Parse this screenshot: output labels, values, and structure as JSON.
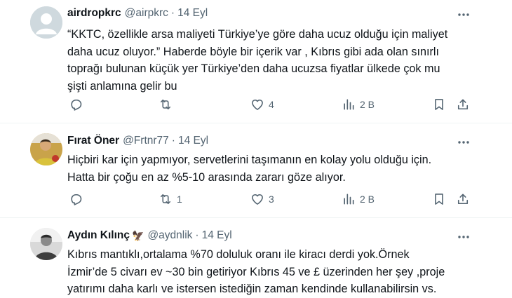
{
  "tweets": [
    {
      "name": "airdropkrc",
      "handle": "@airpkrc",
      "separator": "·",
      "date": "14 Eyl",
      "lines": [
        "“KKTC, özellikle arsa maliyeti Türkiye’ye göre daha ucuz olduğu için maliyet",
        "daha ucuz oluyor.”  Haberde böyle bir içerik var , Kıbrıs gibi ada olan sınırlı",
        "toprağı bulunan küçük yer Türkiye’den daha ucuzsa fiyatlar ülkede çok mu",
        "şişti anlamına gelir bu"
      ],
      "actions": {
        "reply": "",
        "retweet": "",
        "like": "4",
        "views": "2 B"
      }
    },
    {
      "name": "Fırat Öner",
      "handle": "@Frtnr77",
      "separator": "·",
      "date": "14 Eyl",
      "lines": [
        "Hiçbiri kar için yapmıyor,  servetlerini taşımanın en kolay yolu olduğu için.",
        "Hatta bir çoğu en az %5-10 arasında zararı göze alıyor."
      ],
      "actions": {
        "reply": "",
        "retweet": "1",
        "like": "3",
        "views": "2 B"
      }
    },
    {
      "name": "Aydın Kılınç",
      "name_emoji": "🦅",
      "handle": "@aydnlik",
      "separator": "·",
      "date": "14 Eyl",
      "lines": [
        "Kıbrıs mantıklı,ortalama %70 doluluk oranı ile kiracı derdi yok.Örnek",
        "İzmir’de 5 civarı ev ~30 bin getiriyor Kıbrıs 45 ve £ üzerinden her şey ,proje",
        "yatırımı daha karlı ve istersen istediğin zaman kendinde kullanabilirsin vs."
      ]
    }
  ],
  "icons": {
    "reply": "reply-icon",
    "retweet": "retweet-icon",
    "like": "heart-icon",
    "views": "views-chart-icon",
    "bookmark": "bookmark-icon",
    "share": "share-icon",
    "more": "more-dots-icon"
  },
  "colors": {
    "text": "#0f1419",
    "secondary": "#536471",
    "divider": "#eff3f4"
  }
}
